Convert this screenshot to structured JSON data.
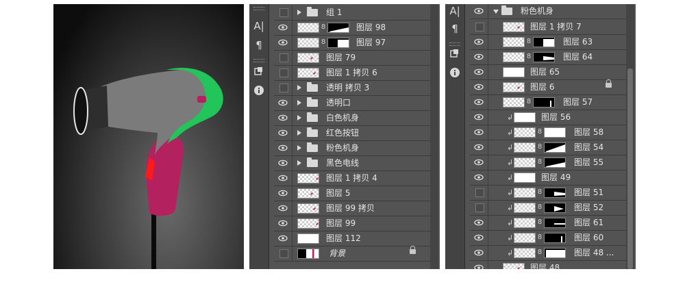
{
  "panel_b": {
    "tools": [
      "A|",
      "¶",
      "i"
    ],
    "layers": [
      {
        "name": "组 1",
        "visible": false,
        "type": "group"
      },
      {
        "name": "图层 98",
        "visible": true,
        "type": "masked"
      },
      {
        "name": "图层 97",
        "visible": true,
        "type": "masked"
      },
      {
        "name": "图层 79",
        "visible": false,
        "type": "pixel"
      },
      {
        "name": "图层 1 拷贝 6",
        "visible": false,
        "type": "pixel"
      },
      {
        "name": "透明 拷贝 3",
        "visible": false,
        "type": "group"
      },
      {
        "name": "透明口",
        "visible": true,
        "type": "group"
      },
      {
        "name": "白色机身",
        "visible": true,
        "type": "group"
      },
      {
        "name": "红色按钮",
        "visible": true,
        "type": "group"
      },
      {
        "name": "粉色机身",
        "visible": true,
        "type": "group"
      },
      {
        "name": "黑色电线",
        "visible": true,
        "type": "group"
      },
      {
        "name": "图层 1 拷贝 4",
        "visible": true,
        "type": "pixel"
      },
      {
        "name": "图层 5",
        "visible": true,
        "type": "pixel"
      },
      {
        "name": "图层 99 拷贝",
        "visible": true,
        "type": "pixel"
      },
      {
        "name": "图层 99",
        "visible": true,
        "type": "pixel"
      },
      {
        "name": "图层 112",
        "visible": true,
        "type": "pixel"
      },
      {
        "name": "背景",
        "visible": false,
        "type": "background",
        "locked": true
      }
    ]
  },
  "panel_c": {
    "tools": [
      "A|",
      "¶",
      "i"
    ],
    "group_name": "粉色机身",
    "layers": [
      {
        "name": "图层 1 拷贝 7",
        "visible": false,
        "clip": false,
        "masked": false
      },
      {
        "name": "图层 63",
        "visible": true,
        "clip": false,
        "masked": true
      },
      {
        "name": "图层 64",
        "visible": true,
        "clip": false,
        "masked": true
      },
      {
        "name": "图层 65",
        "visible": true,
        "clip": false,
        "masked": false
      },
      {
        "name": "图层 6",
        "visible": true,
        "clip": false,
        "masked": false,
        "locked": true
      },
      {
        "name": "图层 57",
        "visible": true,
        "clip": false,
        "masked": true
      },
      {
        "name": "图层 56",
        "visible": true,
        "clip": true,
        "masked": false
      },
      {
        "name": "图层 58",
        "visible": true,
        "clip": true,
        "masked": true
      },
      {
        "name": "图层 54",
        "visible": true,
        "clip": true,
        "masked": true
      },
      {
        "name": "图层 55",
        "visible": true,
        "clip": true,
        "masked": true
      },
      {
        "name": "图层 49",
        "visible": true,
        "clip": true,
        "masked": false
      },
      {
        "name": "图层 51",
        "visible": false,
        "clip": true,
        "masked": true
      },
      {
        "name": "图层 52",
        "visible": false,
        "clip": true,
        "masked": true
      },
      {
        "name": "图层 61",
        "visible": true,
        "clip": true,
        "masked": true
      },
      {
        "name": "图层 60",
        "visible": true,
        "clip": true,
        "masked": true
      },
      {
        "name": "图层 48 ...",
        "visible": true,
        "clip": true,
        "masked": true
      },
      {
        "name": "图层 48",
        "visible": true,
        "clip": false,
        "masked": false
      }
    ]
  },
  "colors": {
    "panel_bg": "#535353",
    "dryer_green": "#22c55a",
    "dryer_pink": "#b3215f",
    "dryer_red": "#ff1a1a",
    "dryer_gray": "#7b7b7b"
  }
}
